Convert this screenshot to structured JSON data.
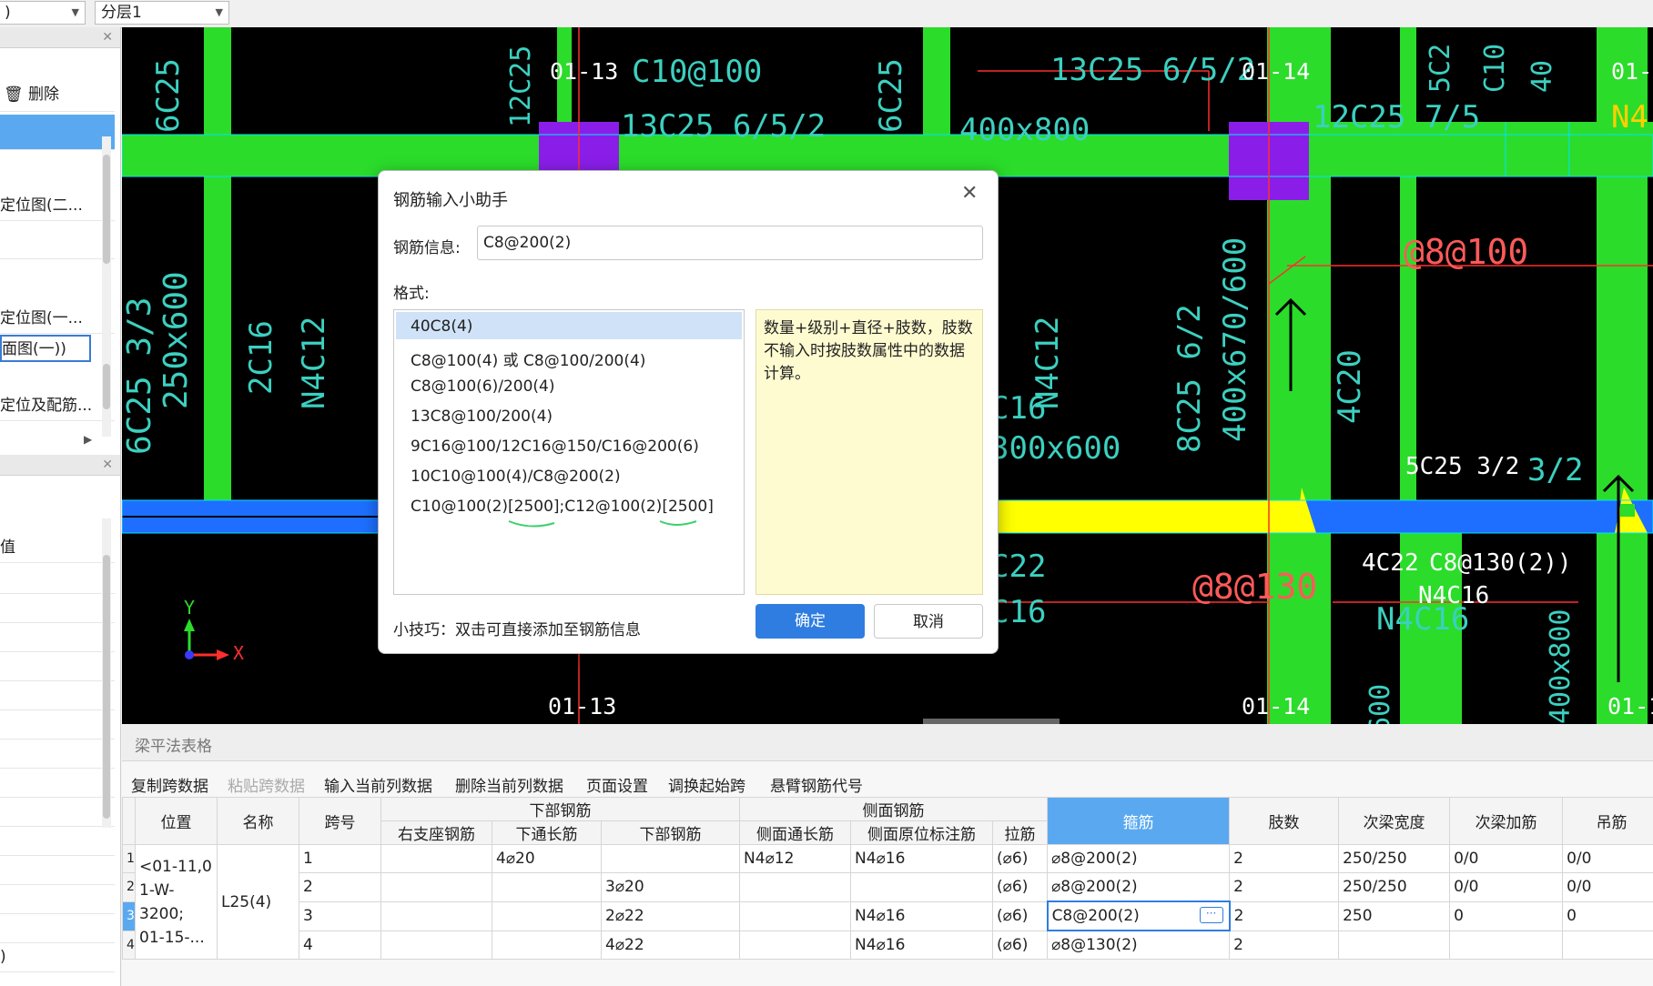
{
  "topbar": {
    "combo1_value": ")",
    "combo2_value": "分层1"
  },
  "left_panel": {
    "delete_label": "删除",
    "items": [
      "定位图(二...",
      "定位图(一...",
      "面图(一))",
      "定位及配筋..."
    ],
    "lower_label": "值",
    "lower_bottom": ")"
  },
  "canvas": {
    "texts": [
      {
        "t": "01-13"
      },
      {
        "t": "C10@100"
      },
      {
        "t": "13C25 6/5/2"
      },
      {
        "t": "12C25"
      },
      {
        "t": "6C25"
      },
      {
        "t": "6C25"
      },
      {
        "t": "13C25 6/5/2"
      },
      {
        "t": "400x800"
      },
      {
        "t": "01-14"
      },
      {
        "t": "12C25 7/5"
      },
      {
        "t": "5C2"
      },
      {
        "t": "C10"
      },
      {
        "t": "40"
      },
      {
        "t": "01-1"
      },
      {
        "t": "N4"
      },
      {
        "t": "@8@100"
      },
      {
        "t": "6C25 3/3"
      },
      {
        "t": "250x600"
      },
      {
        "t": "2C16"
      },
      {
        "t": "N4C12"
      },
      {
        "t": "N4C12"
      },
      {
        "t": "C16"
      },
      {
        "t": "300x600"
      },
      {
        "t": "8C25 6/2"
      },
      {
        "t": "400x670/600"
      },
      {
        "t": "4C20"
      },
      {
        "t": "5C25 3/2"
      },
      {
        "t": "3/2"
      },
      {
        "t": "4C22"
      },
      {
        "t": "C8@130(2))"
      },
      {
        "t": "N4C16"
      },
      {
        "t": "N4C16"
      },
      {
        "t": "@8@130"
      },
      {
        "t": "C22"
      },
      {
        "t": "C16"
      },
      {
        "t": "01-13"
      },
      {
        "t": "01-14"
      },
      {
        "t": "600"
      },
      {
        "t": "01-1"
      },
      {
        "t": "400x800"
      },
      {
        "t": "Y"
      },
      {
        "t": "X"
      }
    ]
  },
  "dialog": {
    "title": "钢筋输入小助手",
    "info_label": "钢筋信息:",
    "info_value": "C8@200(2)",
    "format_label": "格式:",
    "formats": [
      "40C8(4)",
      "C8@100(4) 或 C8@100/200(4)",
      "C8@100(6)/200(4)",
      "13C8@100/200(4)",
      "9C16@100/12C16@150/C16@200(6)",
      "10C10@100(4)/C8@200(2)",
      "C10@100(2)[2500];C12@100(2)[2500]"
    ],
    "description": "数量+级别+直径+肢数，肢数不输入时按肢数属性中的数据计算。",
    "tip": "小技巧：双击可直接添加至钢筋信息",
    "ok": "确定",
    "cancel": "取消"
  },
  "bottom": {
    "title": "梁平法表格",
    "toolbar": [
      "复制跨数据",
      "粘贴跨数据",
      "输入当前列数据",
      "删除当前列数据",
      "页面设置",
      "调换起始跨",
      "悬臂钢筋代号"
    ],
    "groups": {
      "lower": "下部钢筋",
      "side": "侧面钢筋"
    },
    "columns": [
      "位置",
      "名称",
      "跨号",
      "右支座钢筋",
      "下通长筋",
      "下部钢筋",
      "侧面通长筋",
      "侧面原位标注筋",
      "拉筋",
      "箍筋",
      "肢数",
      "次梁宽度",
      "次梁加筋",
      "吊筋"
    ],
    "row_nums": [
      "1",
      "2",
      "3",
      "4"
    ],
    "position": "<01-11,0 1-W-3200; 01-15-...",
    "name": "L25(4)",
    "rows": [
      {
        "span": "1",
        "right": "",
        "lower_through": "4⌀20",
        "lower": "",
        "side_through": "N4⌀12",
        "side_orig": "N4⌀16",
        "tie": "(⌀6)",
        "stirrup": "⌀8@200(2)",
        "legs": "2",
        "sec_width": "250/250",
        "sec_add": "0/0",
        "hanger": "0/0"
      },
      {
        "span": "2",
        "right": "",
        "lower_through": "",
        "lower": "3⌀20",
        "side_through": "",
        "side_orig": "",
        "tie": "(⌀6)",
        "stirrup": "⌀8@200(2)",
        "legs": "2",
        "sec_width": "250/250",
        "sec_add": "0/0",
        "hanger": "0/0"
      },
      {
        "span": "3",
        "right": "",
        "lower_through": "",
        "lower": "2⌀22",
        "side_through": "",
        "side_orig": "N4⌀16",
        "tie": "(⌀6)",
        "stirrup": "C8@200(2)",
        "legs": "2",
        "sec_width": "250",
        "sec_add": "0",
        "hanger": "0"
      },
      {
        "span": "4",
        "right": "",
        "lower_through": "",
        "lower": "4⌀22",
        "side_through": "",
        "side_orig": "N4⌀16",
        "tie": "(⌀6)",
        "stirrup": "⌀8@130(2)",
        "legs": "2",
        "sec_width": "",
        "sec_add": "",
        "hanger": ""
      }
    ]
  }
}
